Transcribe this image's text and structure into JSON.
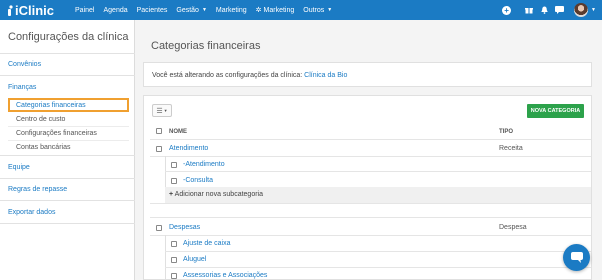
{
  "brand": {
    "name": "iClinic",
    "color": "#1b7bc4"
  },
  "nav": {
    "items": [
      {
        "label": "Painel"
      },
      {
        "label": "Agenda"
      },
      {
        "label": "Pacientes"
      },
      {
        "label": "Gestão",
        "caret": "▼"
      },
      {
        "label": "Marketing"
      },
      {
        "label": "Marketing",
        "icon": "gear-icon"
      },
      {
        "label": "Outros",
        "caret": "▼"
      }
    ]
  },
  "sidebar": {
    "title": "Configurações da clínica",
    "links": {
      "convenios": "Convênios",
      "financas": "Finanças",
      "equipe": "Equipe",
      "repasse": "Regras de repasse",
      "exportar": "Exportar dados"
    },
    "finance_items": [
      {
        "label": "Categorias financeiras",
        "active": true
      },
      {
        "label": "Centro de custo"
      },
      {
        "label": "Configurações financeiras"
      },
      {
        "label": "Contas bancárias"
      }
    ]
  },
  "main": {
    "title": "Categorias financeiras",
    "info_prefix": "Você está alterando as configurações da clínica:",
    "clinic_name": "Clínica da Bio",
    "new_button": "NOVA CATEGORIA",
    "columns": {
      "name": "NOME",
      "type": "TIPO"
    },
    "categories": [
      {
        "name": "Atendimento",
        "type": "Receita",
        "subcategories": [
          "-Atendimento",
          "-Consulta"
        ],
        "add_label": "Adicionar nova subcategoria"
      },
      {
        "name": "Despesas",
        "type": "Despesa",
        "subcategories": [
          "Ajuste de caixa",
          "Aluguel",
          "Assessorias e Associações"
        ]
      }
    ]
  },
  "colors": {
    "primary": "#1b7bc4",
    "success": "#2ca24b",
    "highlight": "#f0a030"
  }
}
